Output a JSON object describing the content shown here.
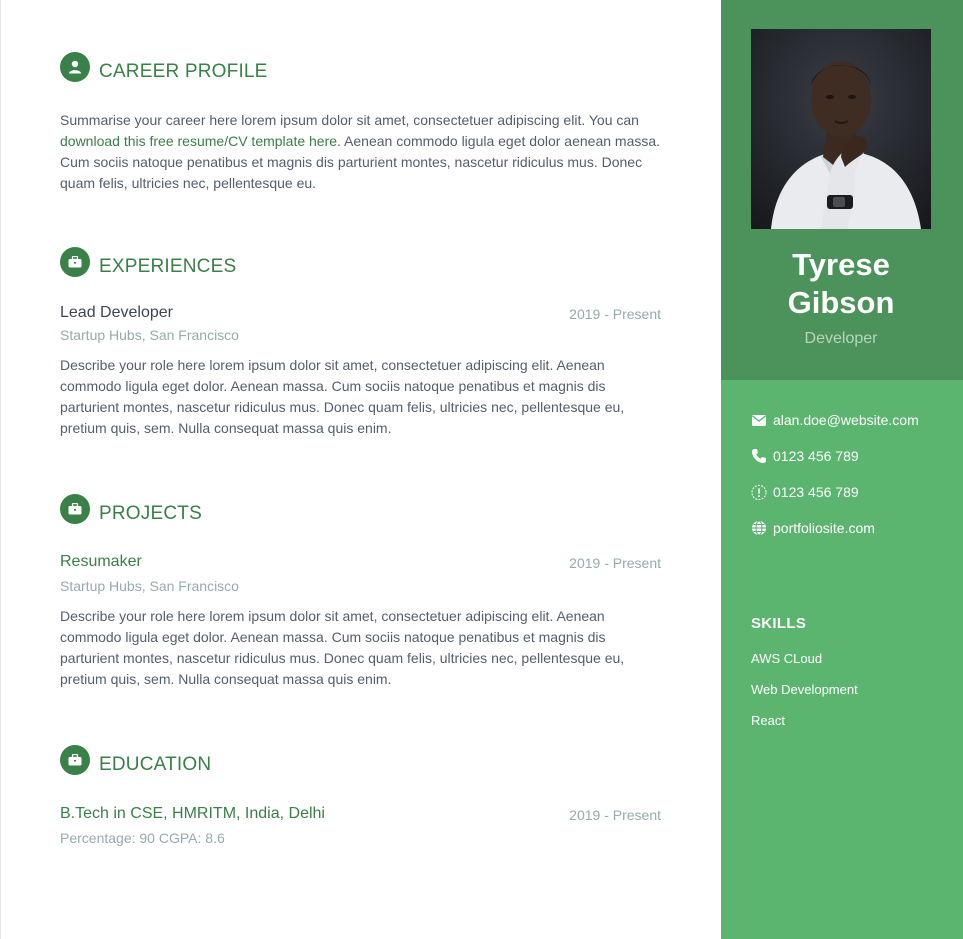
{
  "career": {
    "title": "CAREER PROFILE",
    "text_before": "Summarise your career here lorem ipsum dolor sit amet, consectetuer adipiscing elit. You can ",
    "link": "download this free resume/CV template here",
    "text_after": ". Aenean commodo ligula eget dolor aenean massa. Cum sociis natoque penatibus et magnis dis parturient montes, nascetur ridiculus mus. Donec quam felis, ultricies nec, pellentesque eu."
  },
  "experiences": {
    "title": "EXPERIENCES",
    "role": "Lead Developer",
    "date": "2019 - Present",
    "company": "Startup Hubs, San Francisco",
    "description": "Describe your role here lorem ipsum dolor sit amet, consectetuer adipiscing elit. Aenean commodo ligula eget dolor. Aenean massa. Cum sociis natoque penatibus et magnis dis parturient montes, nascetur ridiculus mus. Donec quam felis, ultricies nec, pellentesque eu, pretium quis, sem. Nulla consequat massa quis enim."
  },
  "projects": {
    "title": "PROJECTS",
    "name": "Resumaker",
    "date": "2019 - Present",
    "company": "Startup Hubs, San Francisco",
    "description": "Describe your role here lorem ipsum dolor sit amet, consectetuer adipiscing elit. Aenean commodo ligula eget dolor. Aenean massa. Cum sociis natoque penatibus et magnis dis parturient montes, nascetur ridiculus mus. Donec quam felis, ultricies nec, pellentesque eu, pretium quis, sem. Nulla consequat massa quis enim."
  },
  "education": {
    "title": "EDUCATION",
    "degree": "B.Tech in CSE, HMRITM, India, Delhi",
    "date": "2019 - Present",
    "score": "Percentage: 90 CGPA: 8.6"
  },
  "profile": {
    "first_name": "Tyrese",
    "last_name": "Gibson",
    "role": "Developer"
  },
  "contact": {
    "email": "alan.doe@website.com",
    "phone": "0123 456 789",
    "mobile": "0123 456 789",
    "website": "portfoliosite.com"
  },
  "skills": {
    "title": "SKILLS",
    "items": [
      "AWS CLoud",
      "Web Development",
      "React"
    ]
  },
  "colors": {
    "accent_green": "#3a8049",
    "sidebar_top": "#4b935b",
    "sidebar_bottom": "#5bb56f",
    "muted_text": "#97aaaf"
  },
  "icons": {
    "career": "user-icon",
    "experiences": "briefcase-icon",
    "projects": "briefcase-icon",
    "education": "briefcase-icon",
    "email": "envelope-icon",
    "phone": "phone-icon",
    "mobile": "mobile-alert-icon",
    "website": "globe-icon"
  }
}
